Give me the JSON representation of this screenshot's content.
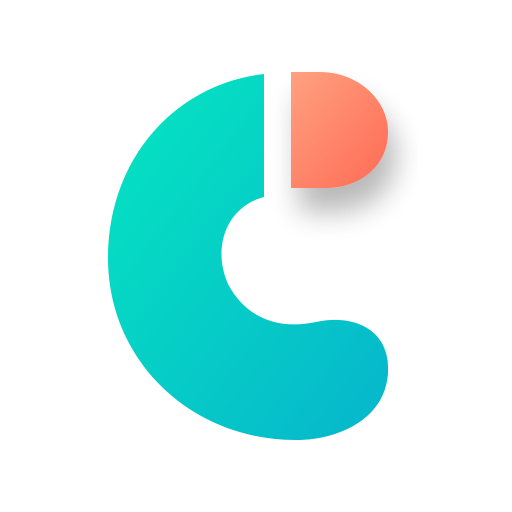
{
  "logo": {
    "icon": "c-letter-logo-icon",
    "colors": {
      "background": "#ffffff",
      "c_gradient_start": "#05E6C1",
      "c_gradient_end": "#06B5CC",
      "tab_gradient_start": "#FFA17F",
      "tab_gradient_end": "#FF6A55",
      "shadow": "#000000"
    }
  }
}
